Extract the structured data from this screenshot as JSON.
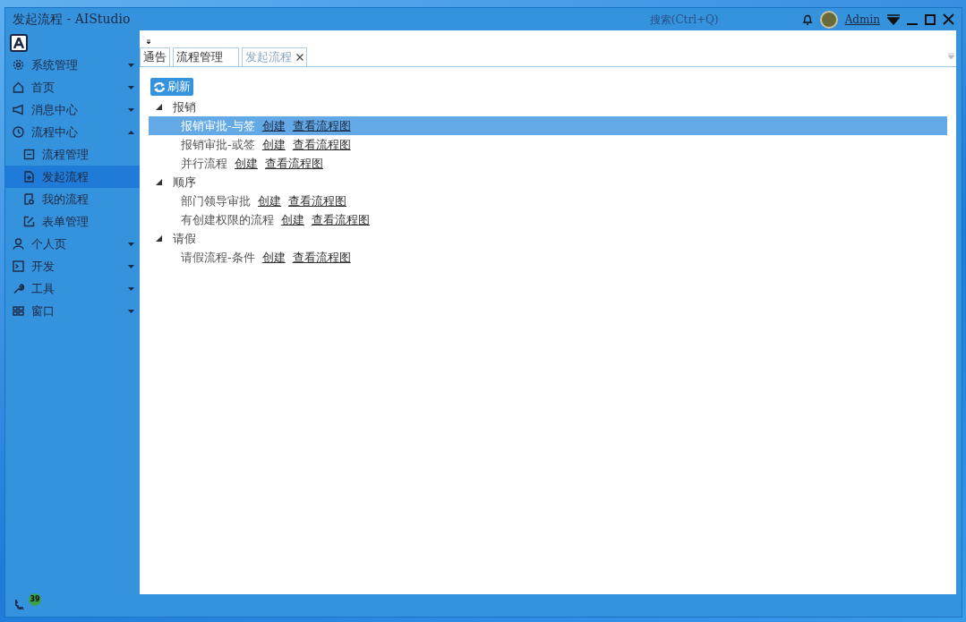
{
  "window": {
    "title": "发起流程 - AIStudio"
  },
  "header": {
    "search": {
      "placeholder": "搜索(Ctrl+Q)"
    },
    "user": "Admin"
  },
  "sidebar": {
    "items": [
      {
        "label": "系统管理",
        "kind": "gear",
        "expanded": false,
        "selected": false
      },
      {
        "label": "首页",
        "kind": "home",
        "expanded": false,
        "selected": false
      },
      {
        "label": "消息中心",
        "kind": "megaphone",
        "expanded": false,
        "selected": false
      },
      {
        "label": "流程中心",
        "kind": "clock",
        "expanded": true,
        "selected": false,
        "children": [
          {
            "label": "流程管理",
            "kind": "square",
            "selected": false
          },
          {
            "label": "发起流程",
            "kind": "file-plus",
            "selected": true
          },
          {
            "label": "我的流程",
            "kind": "file-search",
            "selected": false
          },
          {
            "label": "表单管理",
            "kind": "edit",
            "selected": false
          }
        ]
      },
      {
        "label": "个人页",
        "kind": "person",
        "expanded": false,
        "selected": false
      },
      {
        "label": "开发",
        "kind": "terminal",
        "expanded": false,
        "selected": false
      },
      {
        "label": "工具",
        "kind": "wrench",
        "expanded": false,
        "selected": false
      },
      {
        "label": "窗口",
        "kind": "grid",
        "expanded": false,
        "selected": false
      }
    ]
  },
  "tabs": [
    {
      "label": "通告",
      "selected": false
    },
    {
      "label": "流程管理",
      "selected": false
    },
    {
      "label": "发起流程",
      "selected": true
    }
  ],
  "toolbar": {
    "refresh": "刷新"
  },
  "tree": [
    {
      "label": "报销",
      "expanded": true,
      "children": [
        {
          "label": "报销审批-与签",
          "selected": true,
          "create": "创建",
          "view": "查看流程图"
        },
        {
          "label": "报销审批-或签",
          "selected": false,
          "create": "创建",
          "view": "查看流程图"
        },
        {
          "label": "并行流程",
          "selected": false,
          "create": "创建",
          "view": "查看流程图"
        }
      ]
    },
    {
      "label": "顺序",
      "expanded": true,
      "children": [
        {
          "label": "部门领导审批",
          "selected": false,
          "create": "创建",
          "view": "查看流程图"
        },
        {
          "label": "有创建权限的流程",
          "selected": false,
          "create": "创建",
          "view": "查看流程图"
        }
      ]
    },
    {
      "label": "请假",
      "expanded": true,
      "children": [
        {
          "label": "请假流程-条件",
          "selected": false,
          "create": "创建",
          "view": "查看流程图"
        }
      ]
    }
  ],
  "status_bar": {
    "badge": "39"
  }
}
